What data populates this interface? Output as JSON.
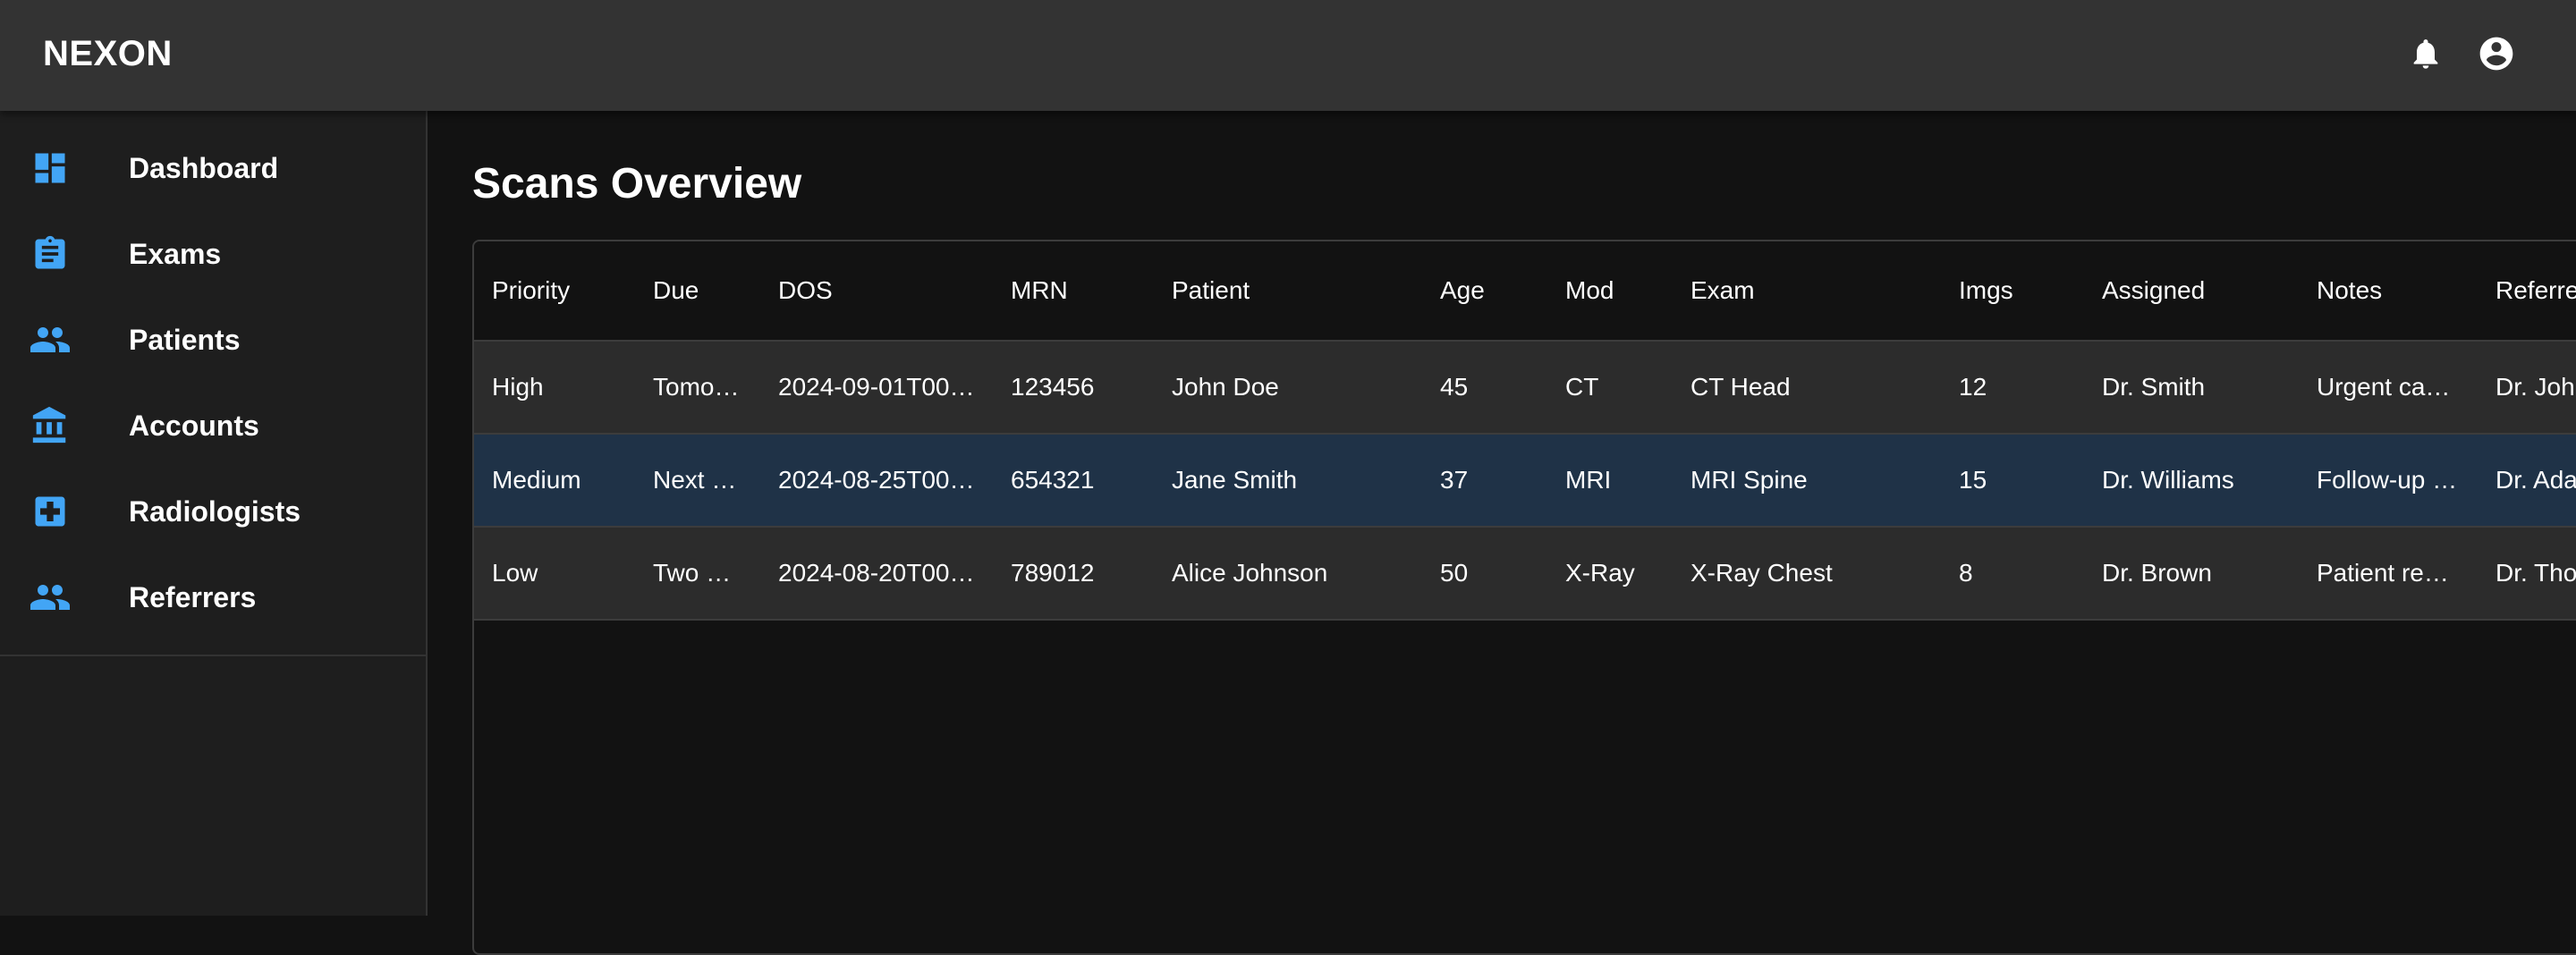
{
  "app": {
    "brand": "NEXON"
  },
  "topbar": {
    "icons": [
      "bell-icon",
      "account-circle-icon"
    ]
  },
  "sidebar": {
    "accent": "#42a5f5",
    "items": [
      {
        "label": "Dashboard",
        "icon": "dashboard-icon"
      },
      {
        "label": "Exams",
        "icon": "clipboard-icon"
      },
      {
        "label": "Patients",
        "icon": "people-icon"
      },
      {
        "label": "Accounts",
        "icon": "bank-icon"
      },
      {
        "label": "Radiologists",
        "icon": "medical-plus-icon"
      },
      {
        "label": "Referrers",
        "icon": "people-icon"
      }
    ]
  },
  "main": {
    "title": "Scans Overview",
    "table": {
      "columns": [
        "Priority",
        "Due",
        "DOS",
        "MRN",
        "Patient",
        "Age",
        "Mod",
        "Exam",
        "Imgs",
        "Assigned",
        "Notes",
        "Referre"
      ],
      "selected_row": 1,
      "rows": [
        [
          "High",
          "Tomo…",
          "2024-09-01T00…",
          "123456",
          "John Doe",
          "45",
          "CT",
          "CT Head",
          "12",
          "Dr. Smith",
          "Urgent ca…",
          "Dr. Joh"
        ],
        [
          "Medium",
          "Next …",
          "2024-08-25T00…",
          "654321",
          "Jane Smith",
          "37",
          "MRI",
          "MRI Spine",
          "15",
          "Dr. Williams",
          "Follow-up …",
          "Dr. Ada"
        ],
        [
          "Low",
          "Two …",
          "2024-08-20T00…",
          "789012",
          "Alice Johnson",
          "50",
          "X-Ray",
          "X-Ray Chest",
          "8",
          "Dr. Brown",
          "Patient re…",
          "Dr. Tho"
        ]
      ]
    }
  }
}
